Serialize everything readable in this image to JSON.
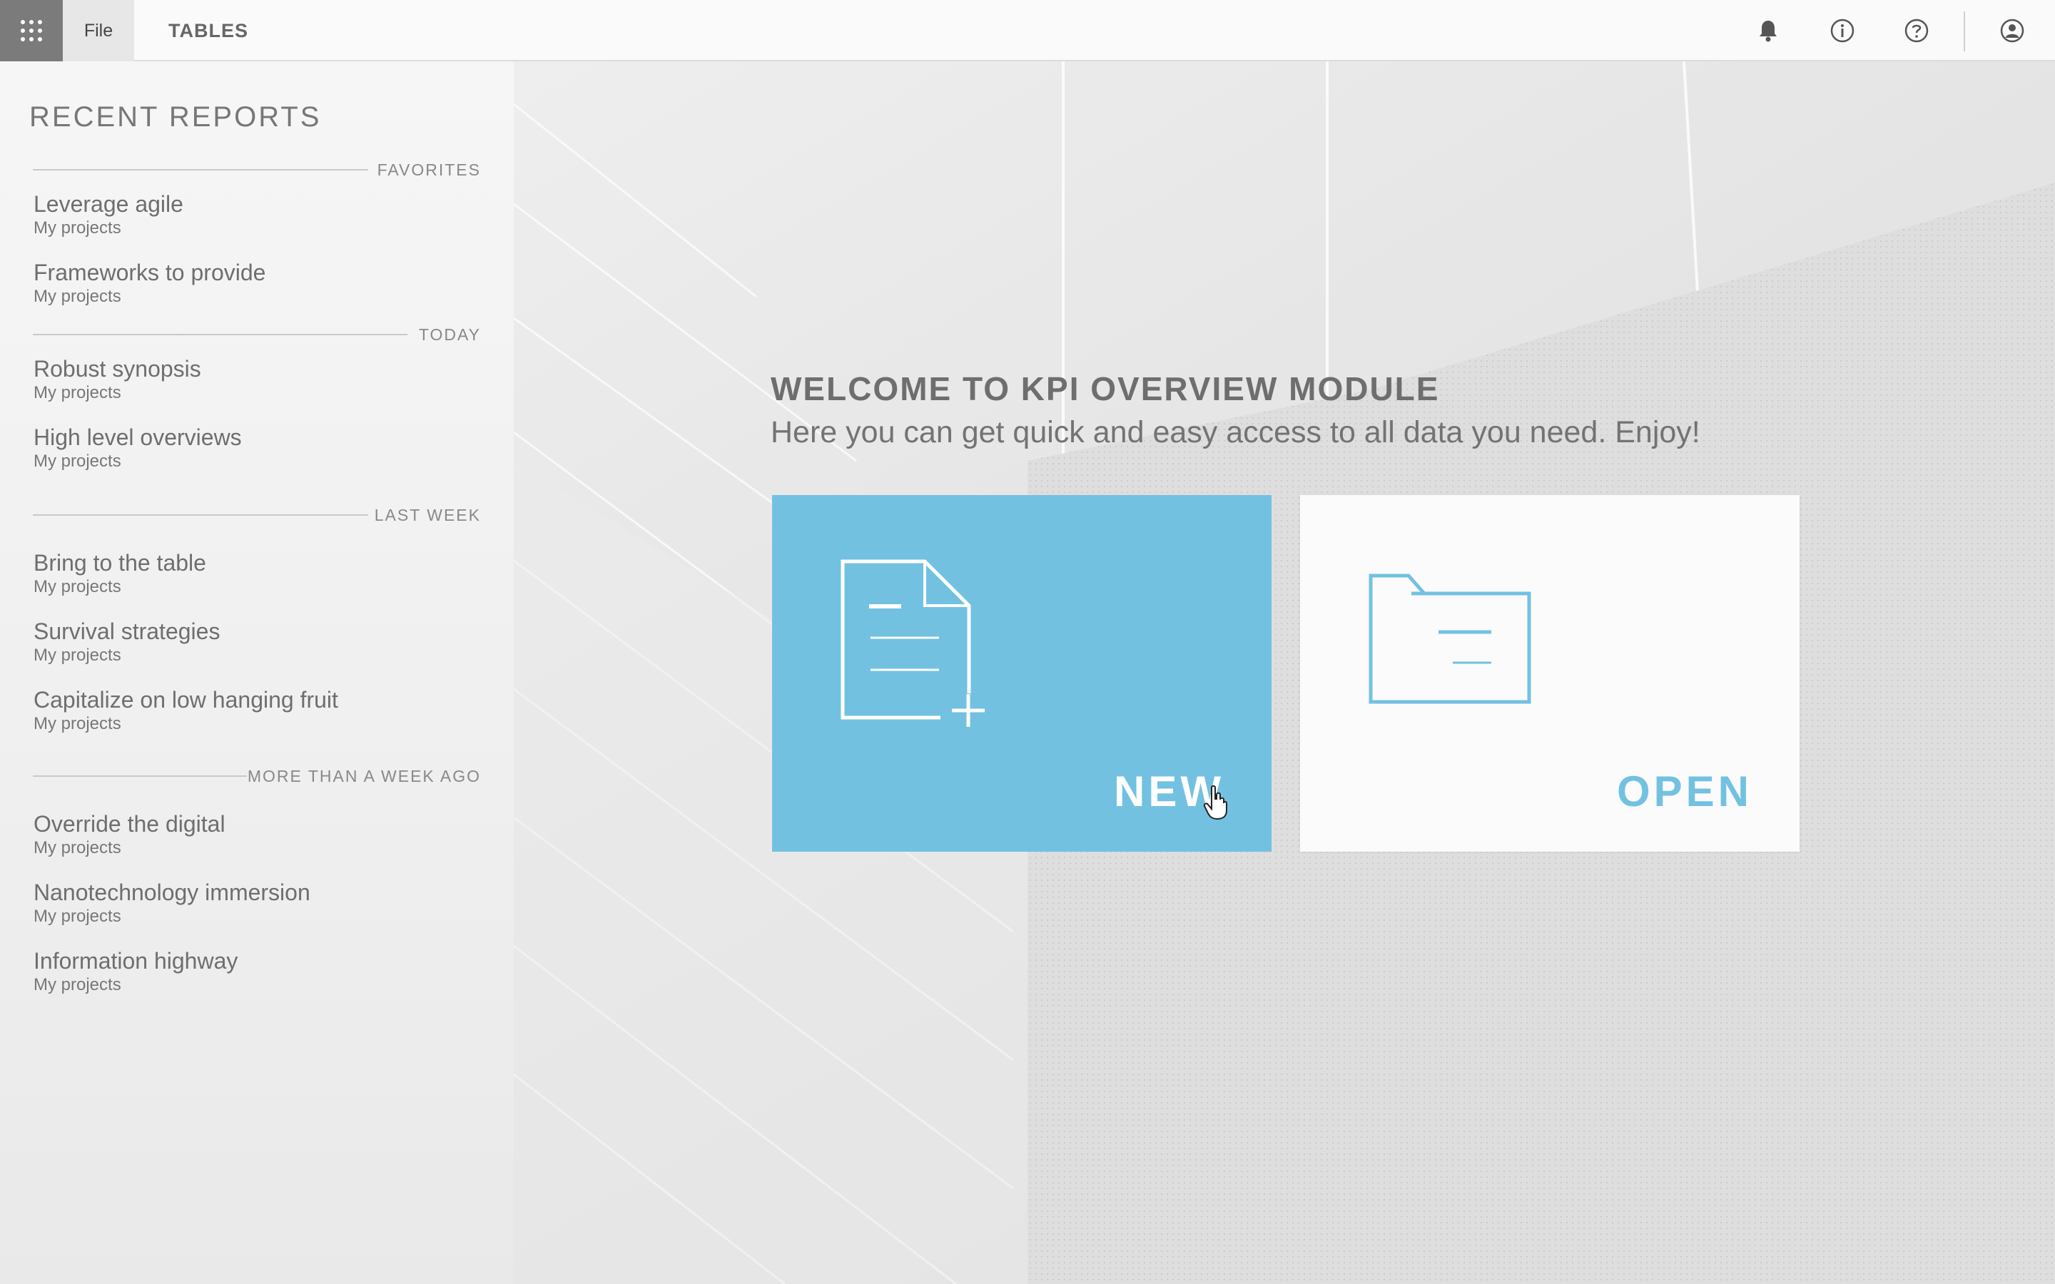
{
  "topbar": {
    "apps_icon": "apps-grid-icon",
    "menu_file": "File",
    "menu_tables": "TABLES",
    "icons": [
      "bell-icon",
      "info-icon",
      "help-icon",
      "user-account-icon"
    ]
  },
  "sidebar": {
    "title": "RECENT REPORTS",
    "sections": {
      "favorites": "FAVORITES",
      "today": "TODAY",
      "last_week": "LAST WEEK",
      "older": "MORE THAN A WEEK AGO"
    },
    "reports": [
      {
        "name": "Leverage agile",
        "folder": "My projects"
      },
      {
        "name": "Frameworks to provide",
        "folder": "My projects"
      },
      {
        "name": "Robust synopsis",
        "folder": "My projects"
      },
      {
        "name": "High level overviews",
        "folder": "My projects"
      },
      {
        "name": "Bring to the table",
        "folder": "My projects"
      },
      {
        "name": "Survival strategies",
        "folder": "My projects"
      },
      {
        "name": "Capitalize on low hanging fruit",
        "folder": "My projects"
      },
      {
        "name": "Override the digital",
        "folder": "My projects"
      },
      {
        "name": "Nanotechnology immersion",
        "folder": "My projects"
      },
      {
        "name": "Information highway",
        "folder": "My projects"
      }
    ]
  },
  "main": {
    "welcome_title": "WELCOME TO KPI OVERVIEW MODULE",
    "welcome_subtitle": "Here you can get quick and easy access to all data you need. Enjoy!",
    "tiles": {
      "new_label": "NEW",
      "open_label": "OPEN"
    }
  },
  "colors": {
    "accent": "#73c1e1",
    "topbar_bg": "#fafafa",
    "apps_button_bg": "#7b7b7b"
  }
}
